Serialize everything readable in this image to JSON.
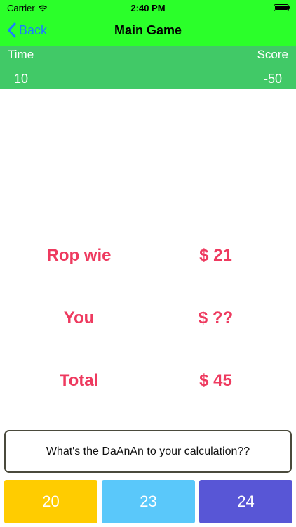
{
  "status_bar": {
    "carrier": "Carrier",
    "time": "2:40 PM",
    "wifi_icon": "wifi-icon",
    "battery_icon": "battery-icon"
  },
  "nav": {
    "back_label": "Back",
    "title": "Main Game",
    "bar_color": "#2bff2a"
  },
  "scoreboard": {
    "time_label": "Time",
    "time_value": "10",
    "score_label": "Score",
    "score_value": "-50",
    "bar_color": "#41c967"
  },
  "rows": [
    {
      "label": "Rop wie",
      "amount": "$ 21"
    },
    {
      "label": "You",
      "amount": "$ ??"
    },
    {
      "label": "Total",
      "amount": "$ 45"
    }
  ],
  "question": "What's the DaAnAn to your calculation??",
  "answers": [
    {
      "label": "20",
      "color": "#ffcc00"
    },
    {
      "label": "23",
      "color": "#5ac8fa"
    },
    {
      "label": "24",
      "color": "#5856d6"
    }
  ]
}
